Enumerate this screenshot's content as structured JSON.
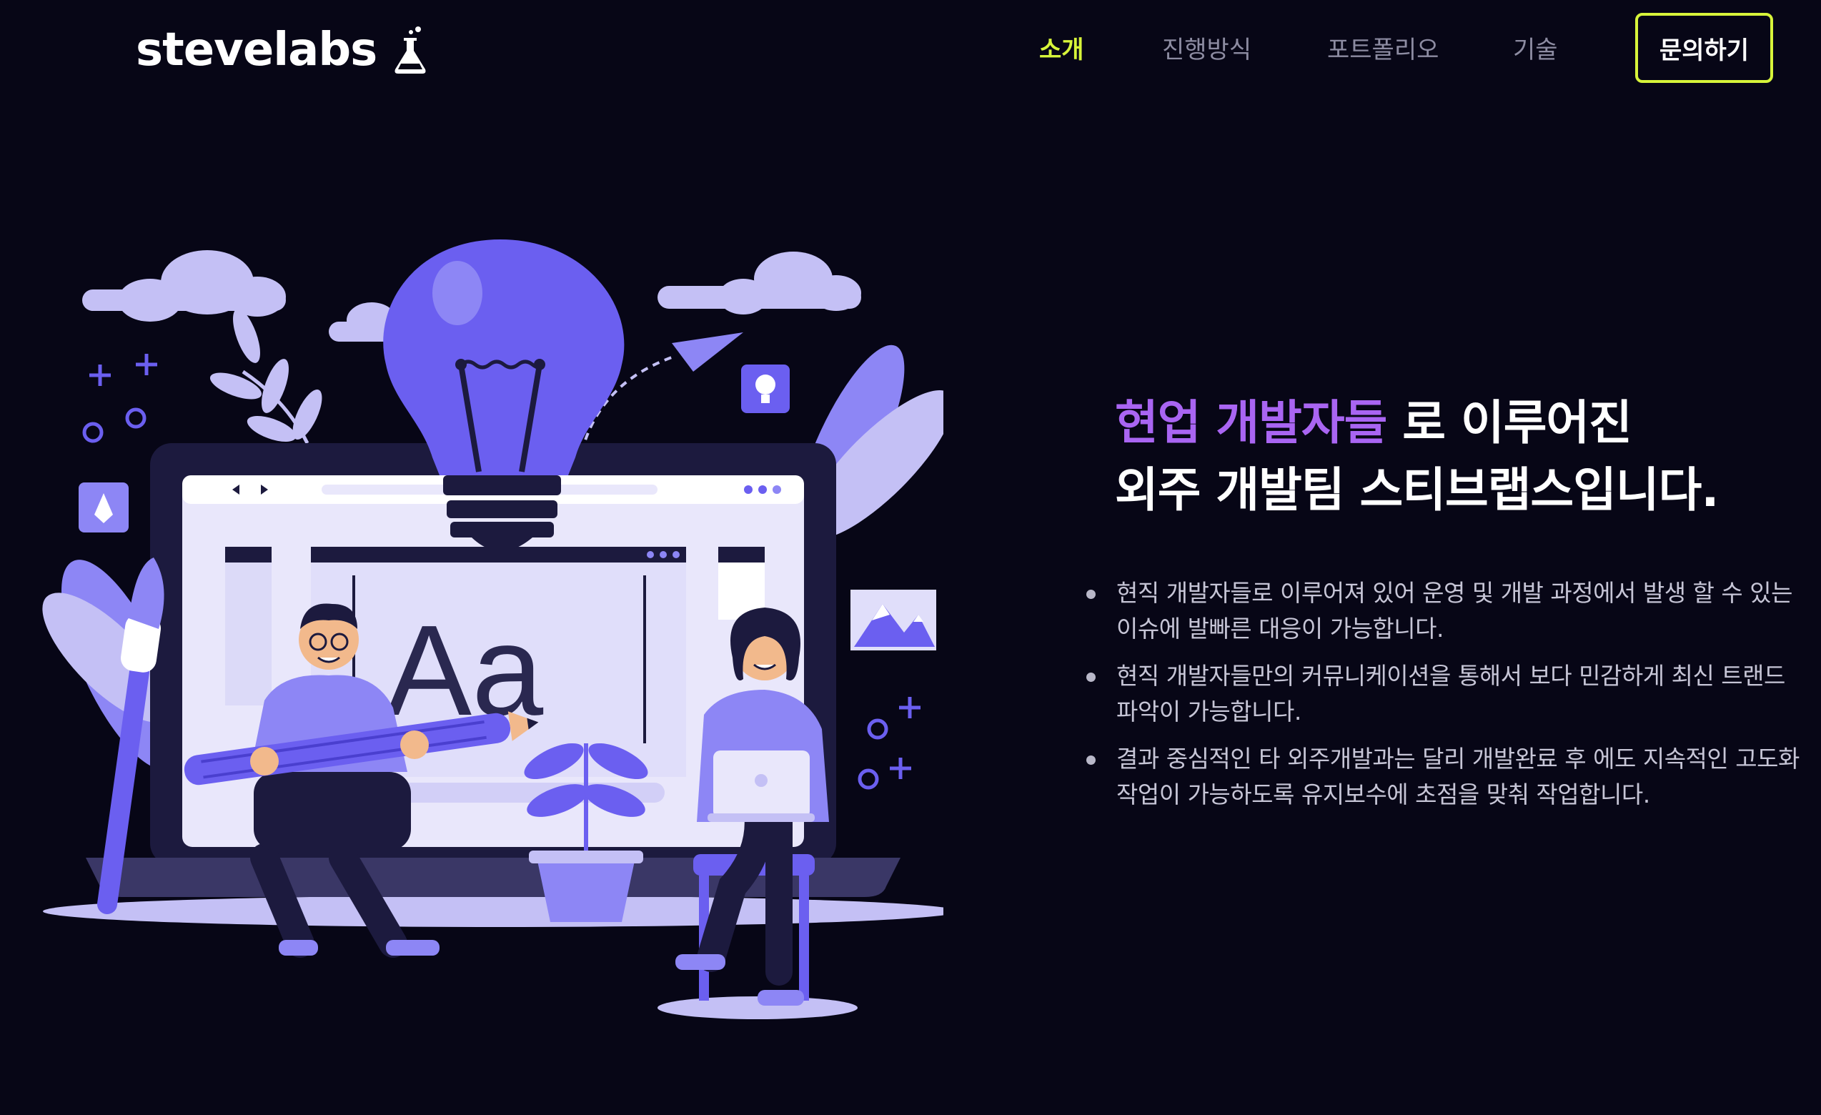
{
  "brand": {
    "name": "stevelabs",
    "icon": "flask-icon"
  },
  "nav": {
    "items": [
      {
        "label": "소개",
        "active": true
      },
      {
        "label": "진행방식",
        "active": false
      },
      {
        "label": "포트폴리오",
        "active": false
      },
      {
        "label": "기술",
        "active": false
      }
    ],
    "contact_label": "문의하기"
  },
  "hero": {
    "headline_accent": "현업 개발자들",
    "headline_rest": " 로 이루어진",
    "headline_line2": "외주 개발팀 스티브랩스입니다.",
    "illustration": {
      "text": "Aa"
    },
    "bullets": [
      "현직 개발자들로 이루어져 있어 운영 및 개발 과정에서 발생 할 수 있는 이슈에 발빠른 대응이 가능합니다.",
      "현직 개발자들만의 커뮤니케이션을 통해서 보다 민감하게 최신 트랜드 파악이 가능합니다.",
      "결과 중심적인 타 외주개발과는 달리 개발완료 후 에도 지속적인 고도화 작업이 가능하도록 유지보수에 초점을 맞춰 작업합니다."
    ]
  },
  "colors": {
    "background": "#070616",
    "accent_nav": "#d7f43a",
    "accent_headline": "#a965f2",
    "illustration_purple": "#6b5ff0",
    "illustration_lavender": "#c4c0f5"
  }
}
